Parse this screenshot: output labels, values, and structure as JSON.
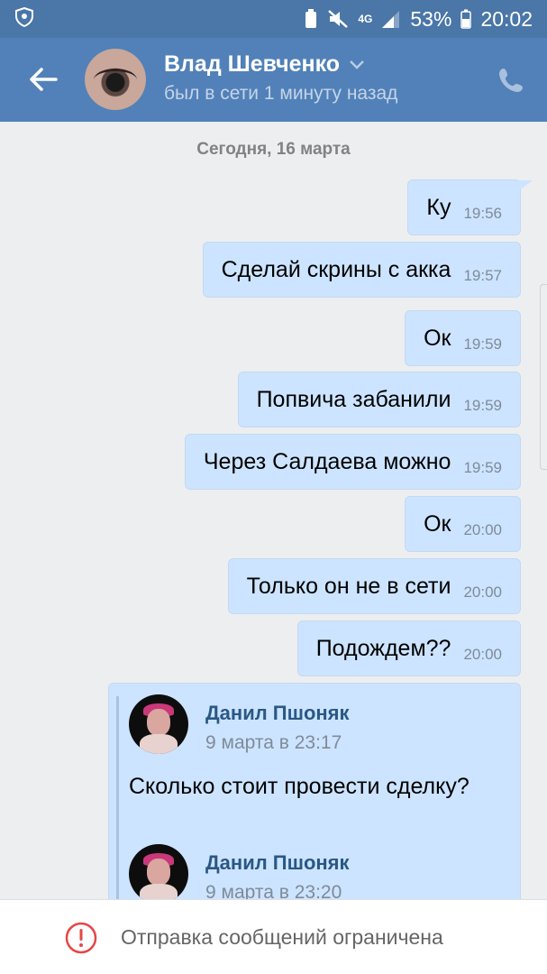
{
  "status_bar": {
    "network": "4G",
    "battery": "53%",
    "time": "20:02"
  },
  "header": {
    "contact_name": "Влад Шевченко",
    "contact_status": "был в сети 1 минуту назад"
  },
  "chat": {
    "date_separator": "Сегодня, 16 марта",
    "messages": [
      {
        "text": "Ку",
        "time": "19:56"
      },
      {
        "text": "Сделай скрины с акка",
        "time": "19:57"
      },
      {
        "text": "Ок",
        "time": "19:59"
      },
      {
        "text": "Попвича забанили",
        "time": "19:59"
      },
      {
        "text": "Через Салдаева можно",
        "time": "19:59"
      },
      {
        "text": "Ок",
        "time": "20:00"
      },
      {
        "text": "Только он не в сети",
        "time": "20:00"
      },
      {
        "text": "Подождем??",
        "time": "20:00"
      }
    ],
    "forwarded": [
      {
        "author": "Данил Пшоняк",
        "date": "9 марта в 23:17",
        "text": "Сколько стоит провести сделку?"
      },
      {
        "author": "Данил Пшоняк",
        "date": "9 марта в 23:20"
      }
    ]
  },
  "bottom_bar": {
    "restriction_text": "Отправка сообщений ограничена"
  },
  "colors": {
    "header_bg": "#5181b8",
    "bubble_bg": "#cce4ff",
    "author_link": "#2a5885",
    "warning_red": "#e64646"
  }
}
